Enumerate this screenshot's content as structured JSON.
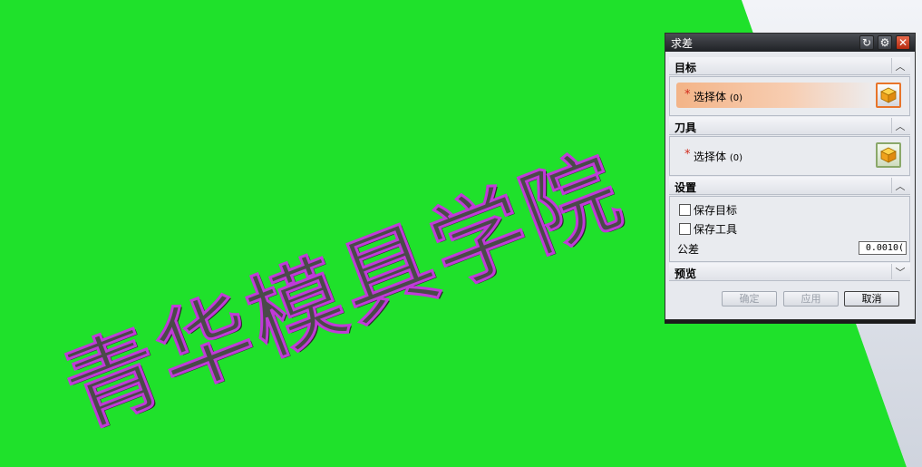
{
  "viewport": {
    "background_color": "#1fe12b",
    "plane_color": "#ffffff",
    "part_text": "青华模具学院",
    "part_text_color": "#4a4a4a",
    "part_edge_color": "#c03ad8"
  },
  "dialog": {
    "title": "求差",
    "titlebar_icons": [
      "reset-icon",
      "gear-icon",
      "close-icon"
    ],
    "target": {
      "header": "目标",
      "select_label": "选择体",
      "select_count": "(0)",
      "required_mark": "*"
    },
    "tool": {
      "header": "刀具",
      "select_label": "选择体",
      "select_count": "(0)",
      "required_mark": "*"
    },
    "settings": {
      "header": "设置",
      "keep_target_label": "保存目标",
      "keep_target_checked": false,
      "keep_tool_label": "保存工具",
      "keep_tool_checked": false,
      "tolerance_label": "公差",
      "tolerance_value": "0.0010("
    },
    "preview": {
      "header": "预览"
    },
    "buttons": {
      "ok": "确定",
      "apply": "应用",
      "cancel": "取消"
    },
    "colors": {
      "accent": "#e8742a",
      "required": "#d12a1a"
    }
  }
}
